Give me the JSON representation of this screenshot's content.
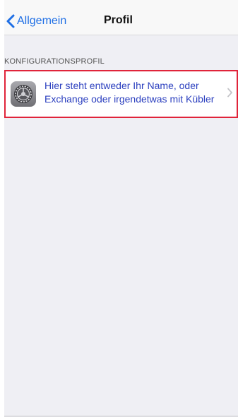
{
  "navbar": {
    "back_label": "Allgemein",
    "back_icon": "chevron-left-icon",
    "title": "Profil"
  },
  "section": {
    "header": "KONFIGURATIONSPROFIL"
  },
  "profile_cell": {
    "icon": "settings-gear-icon",
    "line1": "Hier steht entweder Ihr Name, oder",
    "line2": "Exchange oder irgendetwas mit Kübler",
    "highlight_color": "#e0243a",
    "text_color": "#2b3fbf",
    "chevron_icon": "chevron-right-icon"
  },
  "colors": {
    "accent": "#1f6fe5",
    "background": "#efeff4"
  }
}
